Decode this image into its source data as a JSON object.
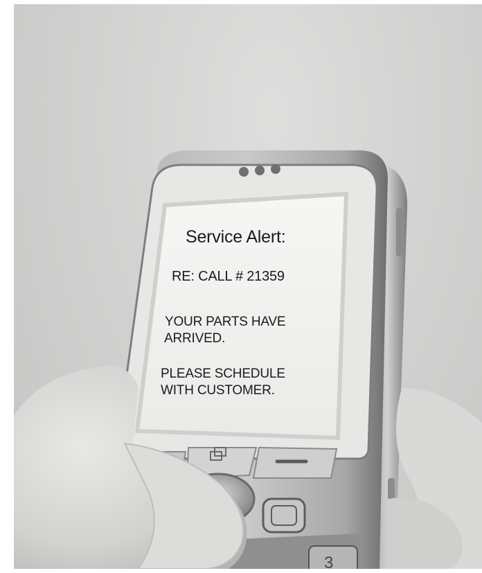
{
  "message": {
    "title": "Service Alert:",
    "call_ref": "RE: CALL # 21359",
    "parts_line1": "YOUR PARTS HAVE",
    "parts_line2": "ARRIVED.",
    "schedule_line1": "PLEASE SCHEDULE",
    "schedule_line2": "WITH CUSTOMER."
  },
  "keypad": {
    "key_3_label": "3"
  },
  "colors": {
    "background": "#d4d4d3",
    "phone_body": "#9a9a9a",
    "screen": "#f2f2f0",
    "text": "#1b1b1b"
  }
}
